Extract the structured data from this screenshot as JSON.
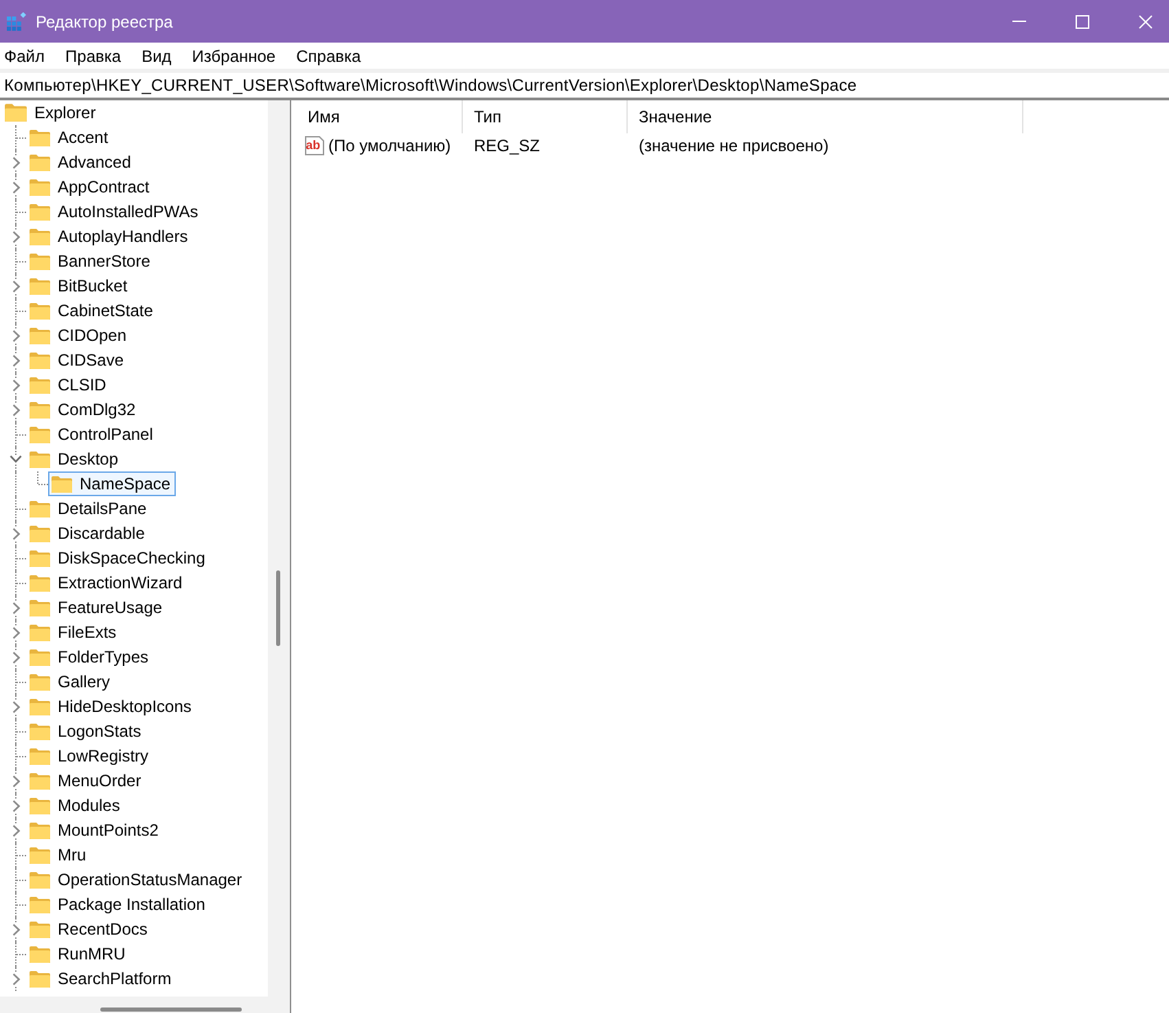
{
  "window": {
    "title": "Редактор реестра"
  },
  "menu": [
    "Файл",
    "Правка",
    "Вид",
    "Избранное",
    "Справка"
  ],
  "address_bar": {
    "value": "Компьютер\\HKEY_CURRENT_USER\\Software\\Microsoft\\Windows\\CurrentVersion\\Explorer\\Desktop\\NameSpace"
  },
  "tree": {
    "root": {
      "label": "Explorer",
      "selected": false,
      "children": [
        {
          "label": "Accent",
          "selected": false
        },
        {
          "label": "Advanced",
          "expanded": false,
          "selected": false
        },
        {
          "label": "AppContract",
          "expanded": false,
          "selected": false
        },
        {
          "label": "AutoInstalledPWAs",
          "selected": false
        },
        {
          "label": "AutoplayHandlers",
          "expanded": false,
          "selected": false
        },
        {
          "label": "BannerStore",
          "selected": false
        },
        {
          "label": "BitBucket",
          "expanded": false,
          "selected": false
        },
        {
          "label": "CabinetState",
          "selected": false
        },
        {
          "label": "CIDOpen",
          "expanded": false,
          "selected": false
        },
        {
          "label": "CIDSave",
          "expanded": false,
          "selected": false
        },
        {
          "label": "CLSID",
          "expanded": false,
          "selected": false
        },
        {
          "label": "ComDlg32",
          "expanded": false,
          "selected": false
        },
        {
          "label": "ControlPanel",
          "selected": false
        },
        {
          "label": "Desktop",
          "expanded": true,
          "selected": false,
          "children": [
            {
              "label": "NameSpace",
              "selected": true
            }
          ]
        },
        {
          "label": "DetailsPane",
          "selected": false
        },
        {
          "label": "Discardable",
          "expanded": false,
          "selected": false
        },
        {
          "label": "DiskSpaceChecking",
          "selected": false
        },
        {
          "label": "ExtractionWizard",
          "selected": false
        },
        {
          "label": "FeatureUsage",
          "expanded": false,
          "selected": false
        },
        {
          "label": "FileExts",
          "expanded": false,
          "selected": false
        },
        {
          "label": "FolderTypes",
          "expanded": false,
          "selected": false
        },
        {
          "label": "Gallery",
          "selected": false
        },
        {
          "label": "HideDesktopIcons",
          "expanded": false,
          "selected": false
        },
        {
          "label": "LogonStats",
          "selected": false
        },
        {
          "label": "LowRegistry",
          "selected": false
        },
        {
          "label": "MenuOrder",
          "expanded": false,
          "selected": false
        },
        {
          "label": "Modules",
          "expanded": false,
          "selected": false
        },
        {
          "label": "MountPoints2",
          "expanded": false,
          "selected": false
        },
        {
          "label": "Mru",
          "selected": false
        },
        {
          "label": "OperationStatusManager",
          "selected": false
        },
        {
          "label": "Package Installation",
          "selected": false
        },
        {
          "label": "RecentDocs",
          "expanded": false,
          "selected": false
        },
        {
          "label": "RunMRU",
          "selected": false
        },
        {
          "label": "SearchPlatform",
          "expanded": false,
          "selected": false
        }
      ]
    }
  },
  "values": {
    "columns": [
      "Имя",
      "Тип",
      "Значение"
    ],
    "rows": [
      {
        "icon_text": "ab",
        "name": "(По умолчанию)",
        "type": "REG_SZ",
        "data": "(значение не присвоено)"
      }
    ]
  }
}
